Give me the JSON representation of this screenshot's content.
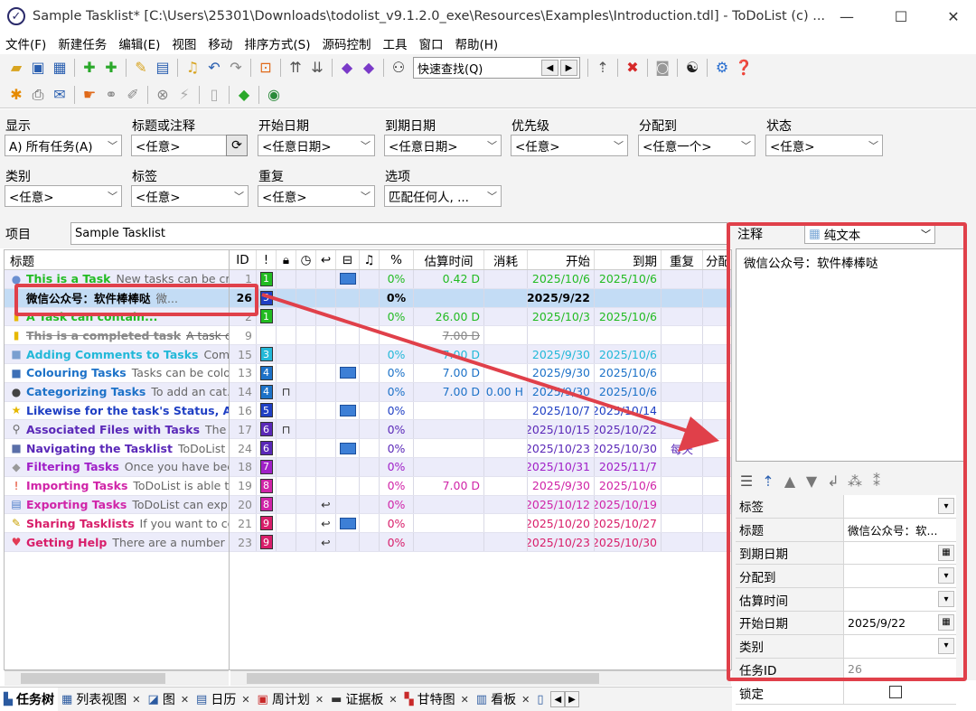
{
  "window": {
    "title": "Sample Tasklist* [C:\\Users\\25301\\Downloads\\todolist_v9.1.2.0_exe\\Resources\\Examples\\Introduction.tdl] - ToDoList (c) ...",
    "minimize": "—",
    "maximize": "☐",
    "close": "✕"
  },
  "menu": [
    "文件(F)",
    "新建任务",
    "编辑(E)",
    "视图",
    "移动",
    "排序方式(S)",
    "源码控制",
    "工具",
    "窗口",
    "帮助(H)"
  ],
  "quickfind": {
    "placeholder": "快速查找(Q)"
  },
  "filters": {
    "show": {
      "label": "显示",
      "value": "A) 所有任务(A)"
    },
    "title": {
      "label": "标题或注释",
      "value": "<任意>"
    },
    "start": {
      "label": "开始日期",
      "value": "<任意日期>"
    },
    "due": {
      "label": "到期日期",
      "value": "<任意日期>"
    },
    "priority": {
      "label": "优先级",
      "value": "<任意>"
    },
    "assigned": {
      "label": "分配到",
      "value": "<任意一个>"
    },
    "status": {
      "label": "状态",
      "value": "<任意>"
    },
    "category": {
      "label": "类别",
      "value": "<任意>"
    },
    "tags": {
      "label": "标签",
      "value": "<任意>"
    },
    "recurrence": {
      "label": "重复",
      "value": "<任意>"
    },
    "options": {
      "label": "选项",
      "value": "匹配任何人, ..."
    }
  },
  "project": {
    "label": "项目",
    "name": "Sample Tasklist"
  },
  "columns": {
    "title": "标题",
    "id": "ID",
    "pct": "%",
    "est": "估算时间",
    "spent": "消耗",
    "start": "开始",
    "due": "到期",
    "recur": "重复",
    "assign": "分配"
  },
  "tasks": [
    {
      "icon": "●",
      "icon_color": "#6b8fd1",
      "name": "This is a Task",
      "comment": "New tasks can be cr...",
      "color": "#22bb22",
      "id": "1",
      "prio": "1",
      "prio_color": "#22bb22",
      "flag": true,
      "lock": false,
      "recur_icon": false,
      "pct": "0%",
      "est": "0.42 D",
      "spent": "",
      "start": "2025/10/6",
      "due": "2025/10/6",
      "recur": "",
      "strike": false
    },
    {
      "icon": "",
      "icon_color": "#333",
      "name": "微信公众号：软件棒棒哒",
      "comment": "微...",
      "color": "#000000",
      "id": "26",
      "prio": "5",
      "prio_color": "#1f3fc4",
      "flag": false,
      "lock": false,
      "recur_icon": false,
      "pct": "0%",
      "est": "",
      "spent": "",
      "start": "2025/9/22",
      "due": "",
      "recur": "",
      "strike": false,
      "selected": true
    },
    {
      "icon": "▮",
      "icon_color": "#e6b800",
      "name": "A Task can contain...",
      "comment": "",
      "color": "#22bb22",
      "id": "2",
      "prio": "1",
      "prio_color": "#22bb22",
      "flag": false,
      "lock": false,
      "recur_icon": false,
      "pct": "0%",
      "est": "26.00 D",
      "spent": "",
      "start": "2025/10/3",
      "due": "2025/10/6",
      "recur": "",
      "strike": false
    },
    {
      "icon": "▮",
      "icon_color": "#e6b800",
      "name": "This is a completed task",
      "comment": "A task c...",
      "color": "#888888",
      "id": "9",
      "prio": "",
      "prio_color": "",
      "flag": false,
      "lock": false,
      "recur_icon": false,
      "pct": "",
      "est": "7.00 D",
      "spent": "",
      "start": "",
      "due": "",
      "recur": "",
      "strike": true
    },
    {
      "icon": "■",
      "icon_color": "#7a9fd0",
      "name": "Adding Comments to Tasks",
      "comment": "Com...",
      "color": "#22b8d8",
      "id": "15",
      "prio": "3",
      "prio_color": "#22b8d8",
      "flag": false,
      "lock": false,
      "recur_icon": false,
      "pct": "0%",
      "est": "7.00 D",
      "spent": "",
      "start": "2025/9/30",
      "due": "2025/10/6",
      "recur": "",
      "strike": false
    },
    {
      "icon": "■",
      "icon_color": "#3d6fb6",
      "name": "Colouring Tasks",
      "comment": "Tasks can be colo...",
      "color": "#1d72c8",
      "id": "13",
      "prio": "4",
      "prio_color": "#1d72c8",
      "flag": true,
      "lock": false,
      "recur_icon": false,
      "pct": "0%",
      "est": "7.00 D",
      "spent": "",
      "start": "2025/9/30",
      "due": "2025/10/6",
      "recur": "",
      "strike": false
    },
    {
      "icon": "●",
      "icon_color": "#444",
      "name": "Categorizing Tasks",
      "comment": "To add an cat...",
      "color": "#1d72c8",
      "id": "14",
      "prio": "4",
      "prio_color": "#1d72c8",
      "flag": false,
      "lock": true,
      "recur_icon": false,
      "pct": "0%",
      "est": "7.00 D",
      "spent": "0.00 H",
      "start": "2025/9/30",
      "due": "2025/10/6",
      "recur": "",
      "strike": false
    },
    {
      "icon": "★",
      "icon_color": "#e6b800",
      "name": "Likewise for the task's Status, Al...",
      "comment": "",
      "color": "#1f3fc4",
      "id": "16",
      "prio": "5",
      "prio_color": "#1f3fc4",
      "flag": true,
      "lock": false,
      "recur_icon": false,
      "pct": "0%",
      "est": "",
      "spent": "",
      "start": "2025/10/7",
      "due": "2025/10/14",
      "recur": "",
      "strike": false
    },
    {
      "icon": "⚲",
      "icon_color": "#666",
      "name": "Associated Files with Tasks",
      "comment": "The ...",
      "color": "#5a28b8",
      "id": "17",
      "prio": "6",
      "prio_color": "#5a28b8",
      "flag": false,
      "lock": true,
      "recur_icon": false,
      "pct": "0%",
      "est": "",
      "spent": "",
      "start": "2025/10/15",
      "due": "2025/10/22",
      "recur": "",
      "strike": false
    },
    {
      "icon": "■",
      "icon_color": "#5a6fa8",
      "name": "Navigating the Tasklist",
      "comment": "ToDoList ...",
      "color": "#5a28b8",
      "id": "24",
      "prio": "6",
      "prio_color": "#5a28b8",
      "flag": true,
      "lock": false,
      "recur_icon": false,
      "pct": "0%",
      "est": "",
      "spent": "",
      "start": "2025/10/23",
      "due": "2025/10/30",
      "recur": "每天",
      "strike": false
    },
    {
      "icon": "◆",
      "icon_color": "#999",
      "name": "Filtering Tasks",
      "comment": "Once you have bee...",
      "color": "#a020c8",
      "id": "18",
      "prio": "7",
      "prio_color": "#a020c8",
      "flag": false,
      "lock": false,
      "recur_icon": false,
      "pct": "0%",
      "est": "",
      "spent": "",
      "start": "2025/10/31",
      "due": "2025/11/7",
      "recur": "",
      "strike": false
    },
    {
      "icon": "!",
      "icon_color": "#e23b1e",
      "name": "Importing Tasks",
      "comment": "ToDoList is able t...",
      "color": "#d024a8",
      "id": "19",
      "prio": "8",
      "prio_color": "#d024a8",
      "flag": false,
      "lock": false,
      "recur_icon": false,
      "pct": "0%",
      "est": "7.00 D",
      "spent": "",
      "start": "2025/9/30",
      "due": "2025/10/6",
      "recur": "",
      "strike": false
    },
    {
      "icon": "▤",
      "icon_color": "#4a7bc8",
      "name": "Exporting Tasks",
      "comment": "ToDoList can exp...",
      "color": "#d024a8",
      "id": "20",
      "prio": "8",
      "prio_color": "#d024a8",
      "flag": false,
      "lock": false,
      "recur_icon": true,
      "pct": "0%",
      "est": "",
      "spent": "",
      "start": "2025/10/12",
      "due": "2025/10/19",
      "recur": "",
      "strike": false
    },
    {
      "icon": "✎",
      "icon_color": "#c8a000",
      "name": "Sharing Tasklists",
      "comment": "If you want to co...",
      "color": "#d81e6a",
      "id": "21",
      "prio": "9",
      "prio_color": "#d81e6a",
      "flag": true,
      "lock": false,
      "recur_icon": true,
      "pct": "0%",
      "est": "",
      "spent": "",
      "start": "2025/10/20",
      "due": "2025/10/27",
      "recur": "",
      "strike": false
    },
    {
      "icon": "♥",
      "icon_color": "#e23b55",
      "name": "Getting Help",
      "comment": "There are a number ...",
      "color": "#d81e6a",
      "id": "23",
      "prio": "9",
      "prio_color": "#d81e6a",
      "flag": false,
      "lock": false,
      "recur_icon": true,
      "pct": "0%",
      "est": "",
      "spent": "",
      "start": "2025/10/23",
      "due": "2025/10/30",
      "recur": "",
      "strike": false
    }
  ],
  "notes": {
    "label": "注释",
    "format": "纯文本",
    "text": "微信公众号：软件棒棒哒"
  },
  "properties": [
    {
      "key": "标签",
      "value": "",
      "control": "dropdown"
    },
    {
      "key": "标题",
      "value": "微信公众号：软...",
      "control": ""
    },
    {
      "key": "到期日期",
      "value": "",
      "control": "date"
    },
    {
      "key": "分配到",
      "value": "",
      "control": "dropdown"
    },
    {
      "key": "估算时间",
      "value": "",
      "control": "dropdown"
    },
    {
      "key": "开始日期",
      "value": "2025/9/22",
      "control": "date"
    },
    {
      "key": "类别",
      "value": "",
      "control": "dropdown"
    },
    {
      "key": "任务ID",
      "value": "26",
      "control": ""
    },
    {
      "key": "锁定",
      "value": "",
      "control": "checkbox"
    }
  ],
  "tabs": [
    {
      "label": "任务树",
      "active": true
    },
    {
      "label": "列表视图",
      "active": false
    },
    {
      "label": "图",
      "active": false
    },
    {
      "label": "日历",
      "active": false
    },
    {
      "label": "周计划",
      "active": false
    },
    {
      "label": "证据板",
      "active": false
    },
    {
      "label": "甘特图",
      "active": false
    },
    {
      "label": "看板",
      "active": false
    }
  ],
  "colors": {
    "highlight": "#e0404a",
    "selection": "#c3dcf5",
    "alt_row": "#ececfa"
  }
}
